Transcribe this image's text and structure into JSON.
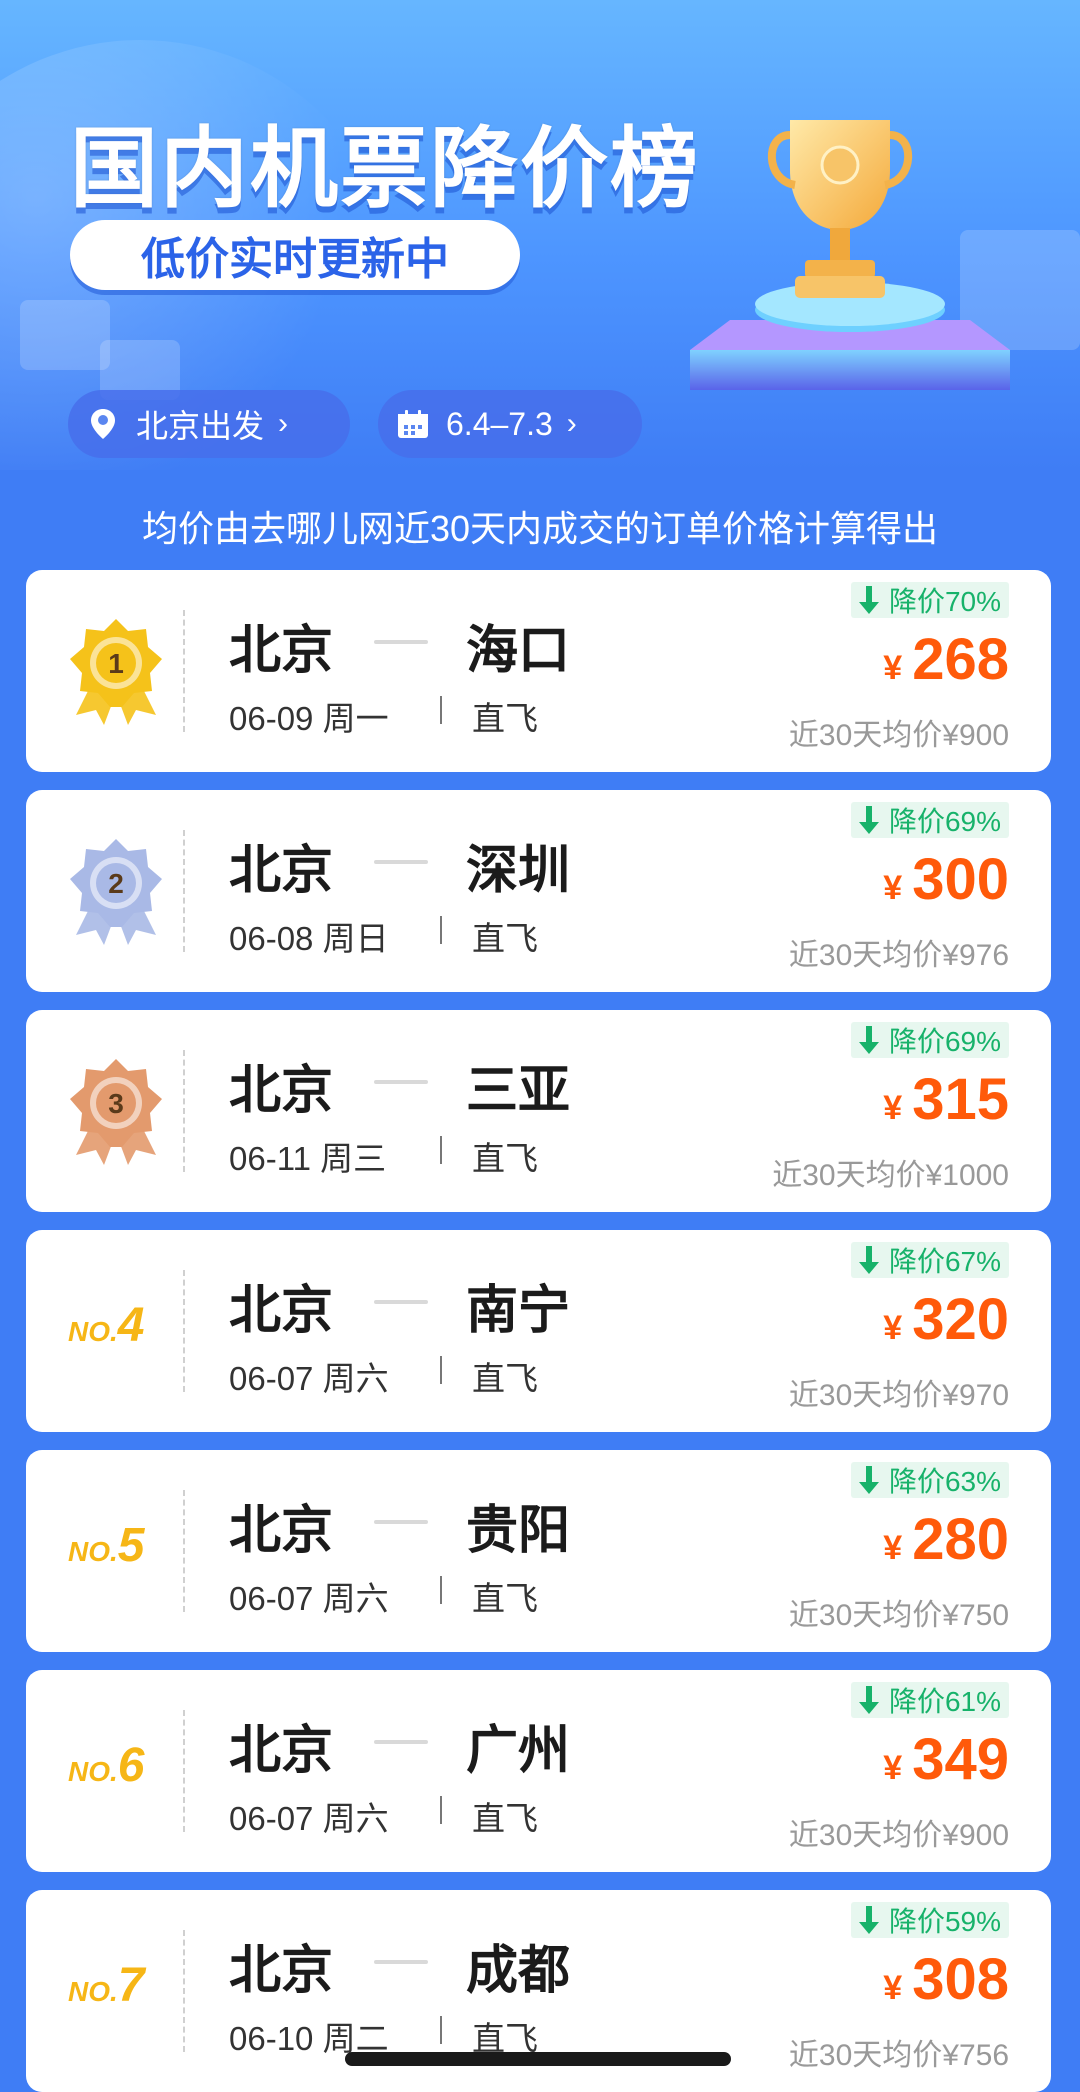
{
  "header": {
    "title": "国内机票降价榜",
    "subtitle": "低价实时更新中",
    "departure_label": "北京出发",
    "date_range_label": "6.4–7.3"
  },
  "note": "均价由去哪儿网近30天内成交的订单价格计算得出",
  "currency_symbol": "¥",
  "items": [
    {
      "rank": "1",
      "rank_prefix": "",
      "from": "北京",
      "to": "海口",
      "date": "06-09 周一",
      "type": "直飞",
      "drop": "降价70%",
      "price": "268",
      "avg": "近30天均价¥900",
      "medal": "gold"
    },
    {
      "rank": "2",
      "rank_prefix": "",
      "from": "北京",
      "to": "深圳",
      "date": "06-08 周日",
      "type": "直飞",
      "drop": "降价69%",
      "price": "300",
      "avg": "近30天均价¥976",
      "medal": "silver"
    },
    {
      "rank": "3",
      "rank_prefix": "",
      "from": "北京",
      "to": "三亚",
      "date": "06-11 周三",
      "type": "直飞",
      "drop": "降价69%",
      "price": "315",
      "avg": "近30天均价¥1000",
      "medal": "bronze"
    },
    {
      "rank": "4",
      "rank_prefix": "NO.",
      "from": "北京",
      "to": "南宁",
      "date": "06-07 周六",
      "type": "直飞",
      "drop": "降价67%",
      "price": "320",
      "avg": "近30天均价¥970",
      "medal": "none"
    },
    {
      "rank": "5",
      "rank_prefix": "NO.",
      "from": "北京",
      "to": "贵阳",
      "date": "06-07 周六",
      "type": "直飞",
      "drop": "降价63%",
      "price": "280",
      "avg": "近30天均价¥750",
      "medal": "none"
    },
    {
      "rank": "6",
      "rank_prefix": "NO.",
      "from": "北京",
      "to": "广州",
      "date": "06-07 周六",
      "type": "直飞",
      "drop": "降价61%",
      "price": "349",
      "avg": "近30天均价¥900",
      "medal": "none"
    },
    {
      "rank": "7",
      "rank_prefix": "NO.",
      "from": "北京",
      "to": "成都",
      "date": "06-10 周二",
      "type": "直飞",
      "drop": "降价59%",
      "price": "308",
      "avg": "近30天均价¥756",
      "medal": "none"
    }
  ],
  "colors": {
    "page_bg": "#3f7df5",
    "price": "#ff5a0a",
    "drop_text": "#17b26a",
    "drop_bg": "#e7f7ef",
    "rank_no": "#f6b616",
    "gold": "#f5c21a",
    "silver": "#a9b9e6",
    "bronze": "#e39a6d"
  },
  "icons": {
    "location": "location-pin-icon",
    "calendar": "calendar-icon",
    "chevron": "chevron-right-icon",
    "drop": "arrow-down-icon",
    "trophy": "trophy-icon"
  }
}
